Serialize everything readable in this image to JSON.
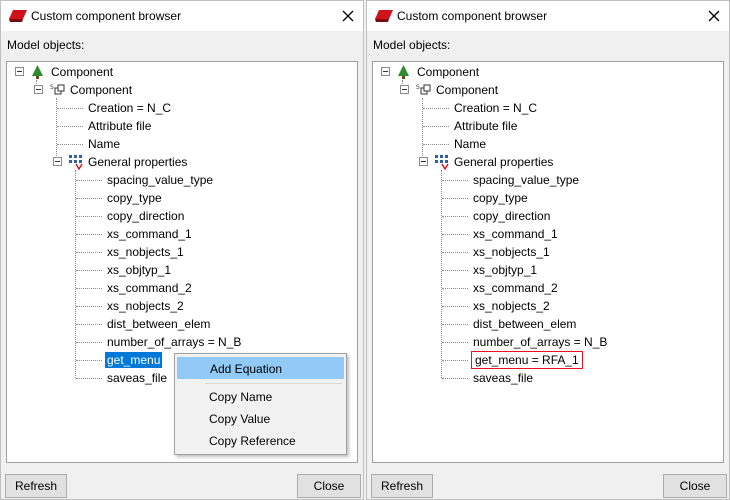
{
  "colors": {
    "selection": "#0078d7",
    "menu_highlight": "#91c9f7",
    "boxed_outline": "#e81123",
    "window_bg": "#f0f0f0"
  },
  "left": {
    "title": "Custom component browser",
    "section_label": "Model objects:",
    "tree": {
      "root": "Component",
      "child": "Component",
      "attrs": [
        "Creation = N_C",
        "Attribute file",
        "Name"
      ],
      "group": "General properties",
      "props": [
        "spacing_value_type",
        "copy_type",
        "copy_direction",
        "xs_command_1",
        "xs_nobjects_1",
        "xs_objtyp_1",
        "xs_command_2",
        "xs_nobjects_2",
        "dist_between_elem",
        "number_of_arrays = N_B",
        "get_menu",
        "saveas_file"
      ]
    },
    "context_menu": [
      "Add Equation",
      "Copy Name",
      "Copy Value",
      "Copy Reference"
    ],
    "buttons": {
      "refresh": "Refresh",
      "close": "Close"
    }
  },
  "right": {
    "title": "Custom component browser",
    "section_label": "Model objects:",
    "tree": {
      "root": "Component",
      "child": "Component",
      "attrs": [
        "Creation = N_C",
        "Attribute file",
        "Name"
      ],
      "group": "General properties",
      "props": [
        "spacing_value_type",
        "copy_type",
        "copy_direction",
        "xs_command_1",
        "xs_nobjects_1",
        "xs_objtyp_1",
        "xs_command_2",
        "xs_nobjects_2",
        "dist_between_elem",
        "number_of_arrays = N_B",
        "get_menu = RFA_1",
        "saveas_file"
      ]
    },
    "buttons": {
      "refresh": "Refresh",
      "close": "Close"
    }
  },
  "icons": [
    "app-logo-icon",
    "close-icon",
    "component-tree-icon",
    "component-object-icon",
    "properties-group-icon"
  ]
}
